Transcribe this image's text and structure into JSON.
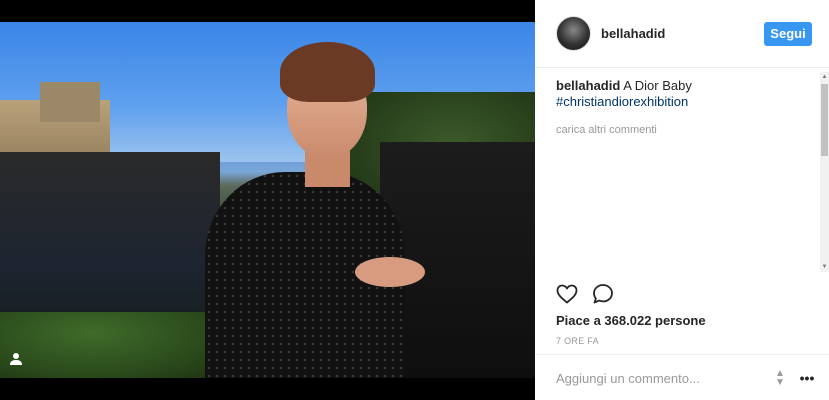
{
  "post": {
    "username": "bellahadid",
    "follow_label": "Segui",
    "caption_author": "bellahadid",
    "caption_text": "A Dior Baby",
    "hashtag": "#christiandiorexhibition",
    "load_more": "carica altri commenti",
    "likes": "Piace a 368.022 persone",
    "timestamp": "7 ORE FA"
  },
  "comment_box": {
    "placeholder": "Aggiungi un commento..."
  },
  "icons": {
    "heart": "heart-icon",
    "comment": "comment-icon",
    "more": "more-options-icon",
    "user_tag": "user-tag-icon"
  },
  "colors": {
    "follow_button": "#3897f0",
    "hashtag": "#003569",
    "text": "#262626",
    "muted": "#999999"
  }
}
